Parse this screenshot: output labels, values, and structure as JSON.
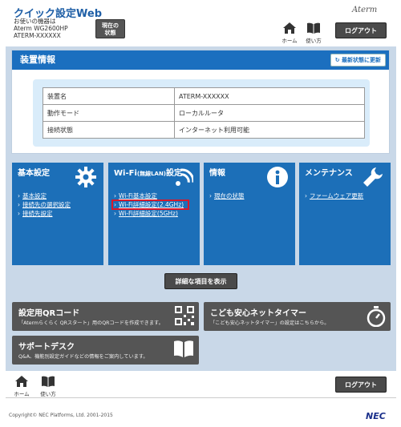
{
  "header": {
    "app_title": "クイック設定Web",
    "device_line1": "お使いの機器は",
    "device_line2": "Aterm WG2600HP",
    "device_line3": "ATERM-XXXXXX",
    "status_button": "現在の状態",
    "brand": "Aterm",
    "home_label": "ホーム",
    "help_label": "使い方",
    "logout_label": "ログアウト"
  },
  "device_info": {
    "heading": "装置情報",
    "refresh_label": "最新状態に更新",
    "rows": [
      {
        "key": "装置名",
        "value": "ATERM-XXXXXX"
      },
      {
        "key": "動作モード",
        "value": "ローカルルータ"
      },
      {
        "key": "接続状態",
        "value": "インターネット利用可能"
      }
    ]
  },
  "tiles": [
    {
      "title": "基本設定",
      "icon": "gear-icon",
      "links": [
        "基本設定",
        "接続先の選択設定",
        "接続先設定"
      ]
    },
    {
      "title": "Wi-Fi",
      "title_small": "(無線LAN)",
      "title_suffix": "設定",
      "title_line2": "定",
      "icon": "wifi-icon",
      "links": [
        "Wi-Fi基本設定",
        "Wi-Fi詳細設定(2.4GHz)",
        "Wi-Fi詳細設定(5GHz)"
      ]
    },
    {
      "title": "情報",
      "icon": "info-icon",
      "links": [
        "現在の状態"
      ]
    },
    {
      "title": "メンテナンス",
      "icon": "wrench-icon",
      "links": [
        "ファームウェア更新"
      ]
    }
  ],
  "more_button": "詳細な項目を表示",
  "boxes": {
    "qr": {
      "title": "設定用QRコード",
      "sub": "「Atermらくらく QRスタート」用のQRコードを作成できます。",
      "icon": "qr-code-icon"
    },
    "timer": {
      "title": "こども安心ネットタイマー",
      "sub": "「こども安心ネットタイマー」の設定はこちらから。",
      "icon": "stopwatch-icon"
    },
    "support": {
      "title": "サポートデスク",
      "sub": "Q&A、機能別設定ガイドなどの情報をご案内しています。",
      "icon": "book-icon"
    }
  },
  "footer": {
    "home_label": "ホーム",
    "help_label": "使い方",
    "logout_label": "ログアウト",
    "copyright": "Copyright© NEC Platforms, Ltd. 2001-2015",
    "nec_logo": "NEC"
  },
  "colors": {
    "accent": "#1c6fb8",
    "highlight": "#d8192b",
    "dark_button": "#4a4a4a"
  }
}
